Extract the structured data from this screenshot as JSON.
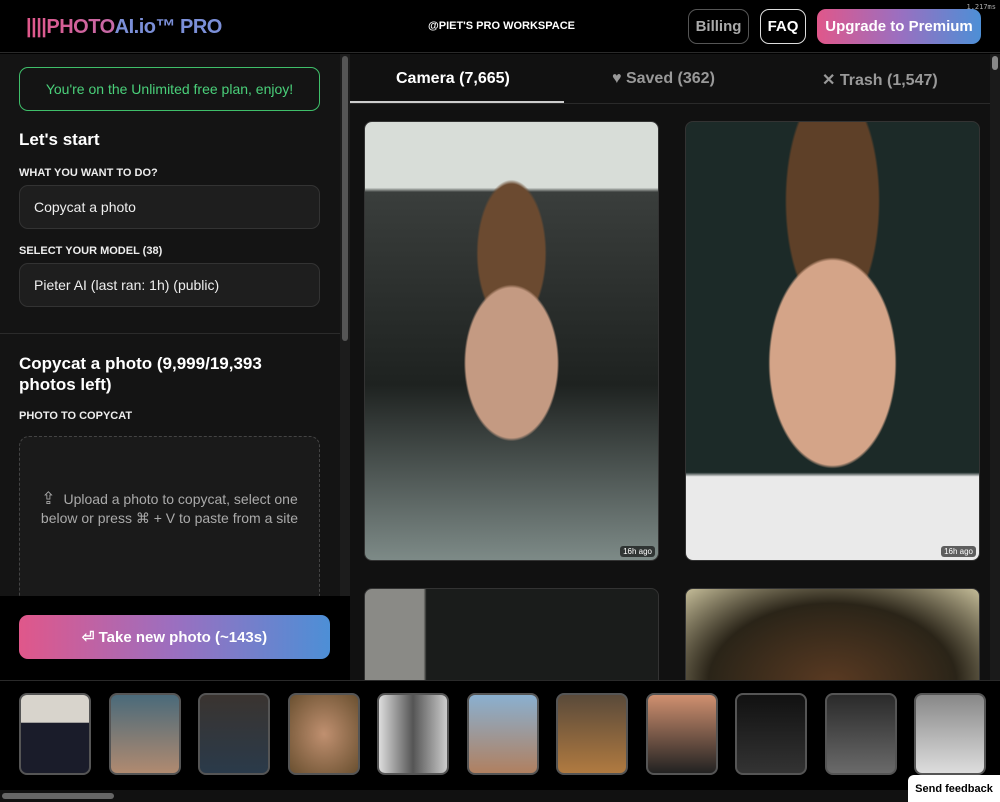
{
  "header": {
    "logo_a": "||||PHOTO",
    "logo_b": "AI.io™ PRO",
    "workspace": "@PIET'S PRO WORKSPACE",
    "timing": "1,217ms",
    "billing": "Billing",
    "faq": "FAQ",
    "upgrade": "Upgrade to Premium"
  },
  "sidebar": {
    "plan_notice": "You're on the Unlimited free plan, enjoy!",
    "lets_start": "Let's start",
    "what_label": "WHAT YOU WANT TO DO?",
    "what_value": "Copycat a photo",
    "model_label": "SELECT YOUR MODEL (38)",
    "model_value": "Pieter AI (last ran: 1h) (public)",
    "section_title": "Copycat a photo (9,999/19,393 photos left)",
    "copycat_label": "PHOTO TO COPYCAT",
    "upload_text": "Upload a photo to copycat, select one below or press ⌘ + V to paste from a site",
    "take_photo": "⏎ Take new photo (~143s)"
  },
  "tabs": [
    {
      "label": "Camera (7,665)",
      "icon": ""
    },
    {
      "label": "Saved (362)",
      "icon": "♥"
    },
    {
      "label": "Trash (1,547)",
      "icon": "✕"
    }
  ],
  "photos": [
    {
      "ago": "16h ago"
    },
    {
      "ago": "16h ago"
    }
  ],
  "feedback": "Send feedback"
}
